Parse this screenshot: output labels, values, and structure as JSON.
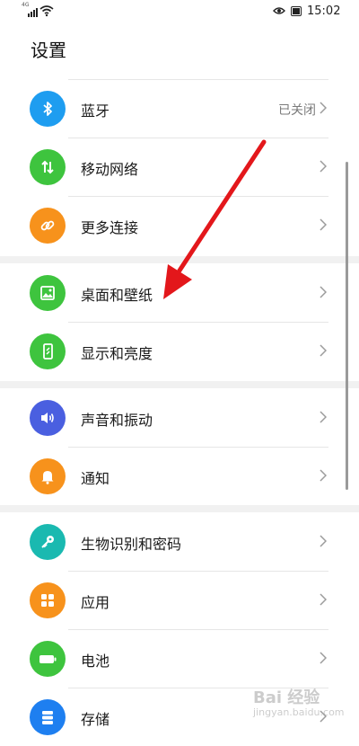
{
  "status_bar": {
    "signal_tag": "4G",
    "time": "15:02"
  },
  "page": {
    "title": "设置"
  },
  "groups": [
    {
      "items": [
        {
          "label": "蓝牙",
          "value": "已关闭",
          "icon": "bluetooth-icon",
          "color": "#1e9df0"
        },
        {
          "label": "移动网络",
          "value": "",
          "icon": "mobile-data-icon",
          "color": "#3ec43e"
        },
        {
          "label": "更多连接",
          "value": "",
          "icon": "link-icon",
          "color": "#f7921c"
        }
      ]
    },
    {
      "items": [
        {
          "label": "桌面和壁纸",
          "value": "",
          "icon": "wallpaper-icon",
          "color": "#3ec43e"
        },
        {
          "label": "显示和亮度",
          "value": "",
          "icon": "display-icon",
          "color": "#3ec43e"
        }
      ]
    },
    {
      "items": [
        {
          "label": "声音和振动",
          "value": "",
          "icon": "sound-icon",
          "color": "#4a5fe0"
        },
        {
          "label": "通知",
          "value": "",
          "icon": "bell-icon",
          "color": "#f7921c"
        }
      ]
    },
    {
      "items": [
        {
          "label": "生物识别和密码",
          "value": "",
          "icon": "key-icon",
          "color": "#1ab9b0"
        },
        {
          "label": "应用",
          "value": "",
          "icon": "apps-icon",
          "color": "#f7921c"
        },
        {
          "label": "电池",
          "value": "",
          "icon": "battery-icon",
          "color": "#3ec43e"
        },
        {
          "label": "存储",
          "value": "",
          "icon": "storage-icon",
          "color": "#1e7ff0"
        }
      ]
    }
  ],
  "annotation": {
    "arrow_color": "#e3171b"
  },
  "watermark": {
    "brand": "Bai 经验",
    "site": "jingyan.baidu.com"
  }
}
